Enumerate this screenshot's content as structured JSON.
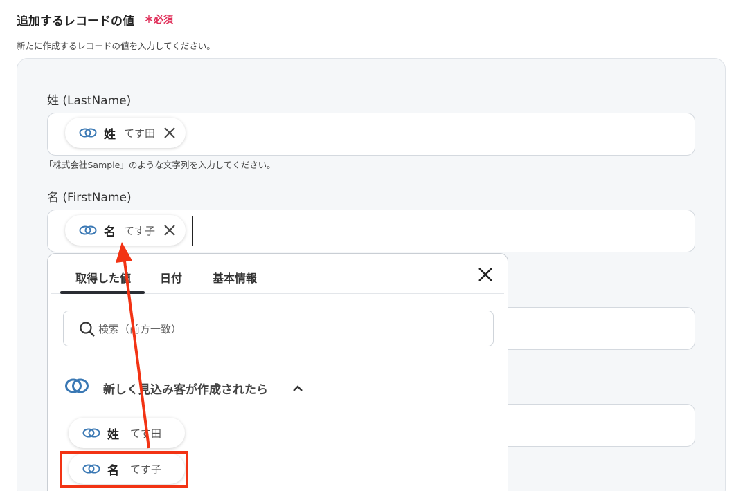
{
  "section": {
    "title": "追加するレコードの値",
    "required": "＊必須",
    "description": "新たに作成するレコードの値を入力してください。"
  },
  "fields": {
    "lastname": {
      "label": "姓 (LastName)",
      "chip_name": "姓",
      "chip_value": "てす田",
      "hint": "「株式会社Sample」のような文字列を入力してください。"
    },
    "firstname": {
      "label": "名 (FirstName)",
      "chip_name": "名",
      "chip_value": "てす子"
    }
  },
  "dropdown": {
    "tabs": [
      {
        "label": "取得した値",
        "active": true
      },
      {
        "label": "日付"
      },
      {
        "label": "基本情報"
      }
    ],
    "search_placeholder": "検索（前方一致）",
    "group_title": "新しく見込み客が作成されたら",
    "items": [
      {
        "name": "姓",
        "value": "てす田"
      },
      {
        "name": "名",
        "value": "てす子",
        "highlighted": true
      }
    ]
  },
  "colors": {
    "required": "#e0305a",
    "link_icon": "#3a78b4",
    "highlight": "#f23314",
    "arrow": "#f23314"
  }
}
